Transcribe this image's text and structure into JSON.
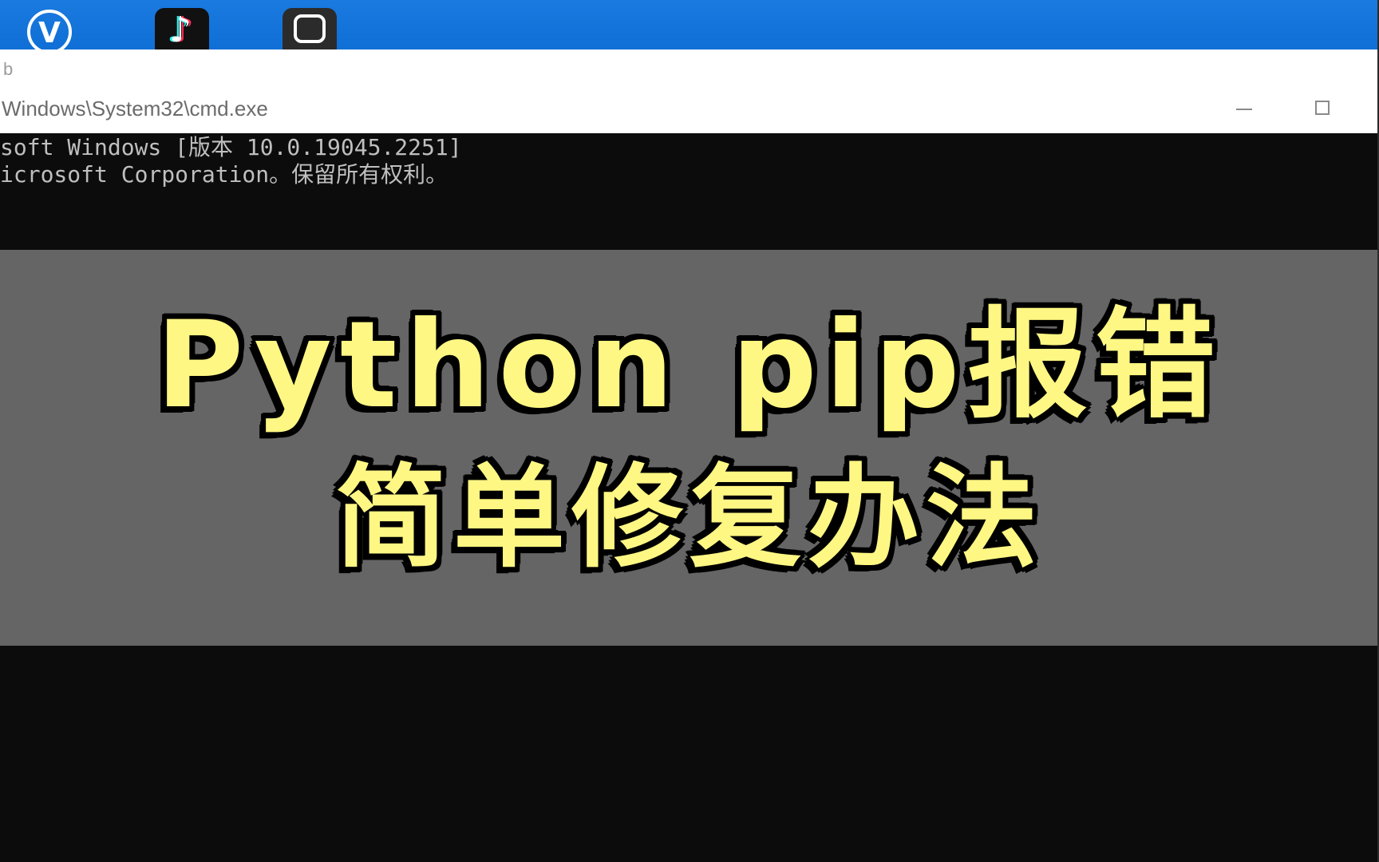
{
  "desktop": {
    "icons": [
      {
        "name": "app-v-icon",
        "glyph": "V"
      },
      {
        "name": "tiktok-icon",
        "glyph": "♪"
      },
      {
        "name": "app-dark-icon",
        "glyph": ""
      }
    ]
  },
  "explorer": {
    "address_fragment": "b"
  },
  "cmd": {
    "title": "Windows\\System32\\cmd.exe",
    "lines": [
      "soft Windows [版本 10.0.19045.2251]",
      "icrosoft Corporation。保留所有权利。"
    ]
  },
  "overlay": {
    "line1": "Python pip报错",
    "line2": "简单修复办法"
  },
  "colors": {
    "overlay_bg": "#656565",
    "overlay_text": "#fef783",
    "console_bg": "#0c0c0c",
    "desktop_bg": "#1a7ae0"
  }
}
